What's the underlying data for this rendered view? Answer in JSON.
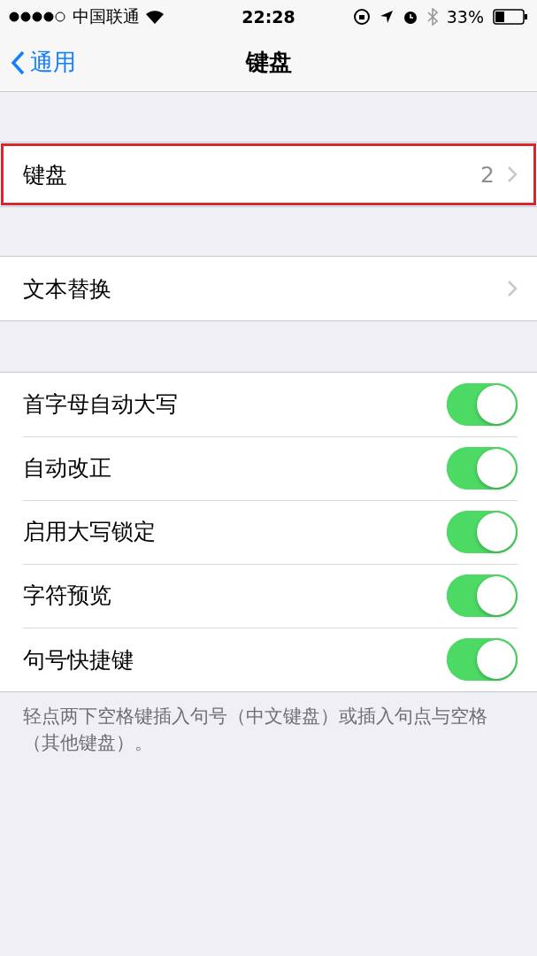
{
  "status_bar": {
    "carrier": "中国联通",
    "time": "22:28",
    "battery": "33%"
  },
  "nav": {
    "back": "通用",
    "title": "键盘"
  },
  "groups": [
    {
      "rows": [
        {
          "kind": "link",
          "label": "键盘",
          "value": "2",
          "highlighted": true
        }
      ]
    },
    {
      "rows": [
        {
          "kind": "link",
          "label": "文本替换",
          "highlighted": false
        }
      ]
    },
    {
      "rows": [
        {
          "kind": "toggle",
          "label": "首字母自动大写",
          "on": true
        },
        {
          "kind": "toggle",
          "label": "自动改正",
          "on": true
        },
        {
          "kind": "toggle",
          "label": "启用大写锁定",
          "on": true
        },
        {
          "kind": "toggle",
          "label": "字符预览",
          "on": true
        },
        {
          "kind": "toggle",
          "label": "句号快捷键",
          "on": true
        }
      ],
      "footer": "轻点两下空格键插入句号（中文键盘）或插入句点与空格（其他键盘）。"
    }
  ]
}
